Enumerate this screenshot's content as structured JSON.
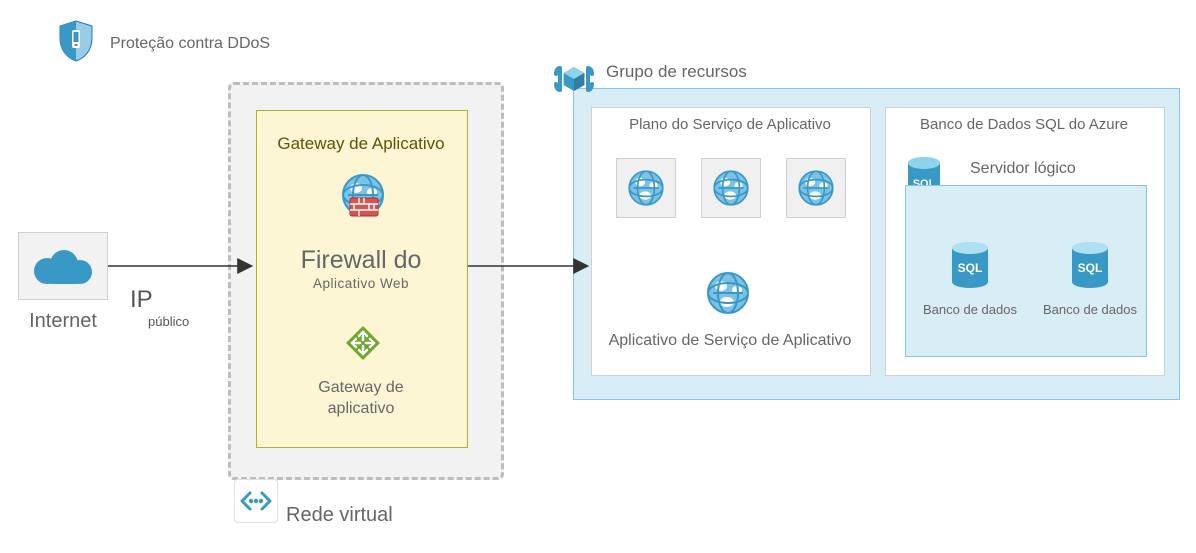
{
  "ddos_label": "Proteção contra DDoS",
  "internet_label": "Internet",
  "ip_label": "IP",
  "ip_sub": "público",
  "vnet_label": "Rede virtual",
  "appgw_title": "Gateway de Aplicativo",
  "firewall_line1": "Firewall do",
  "firewall_line2": "Aplicativo Web",
  "gateway_label": "Gateway de\naplicativo",
  "rg_label": "Grupo de recursos",
  "asp_title": "Plano do Serviço de Aplicativo",
  "asp_app_label": "Aplicativo de Serviço de Aplicativo",
  "sql_box_title": "Banco de Dados SQL do Azure",
  "sql_logical_label": "Servidor lógico",
  "db_label": "Banco de dados",
  "colors": {
    "azure_blue": "#3999c6",
    "light_blue_fill": "#d9edf7",
    "light_blue_border": "#89c4ec",
    "yellow_fill": "#fcf6d5",
    "yellow_border": "#a6b72b",
    "grey_fill": "#f2f2f2",
    "text": "#666464"
  }
}
